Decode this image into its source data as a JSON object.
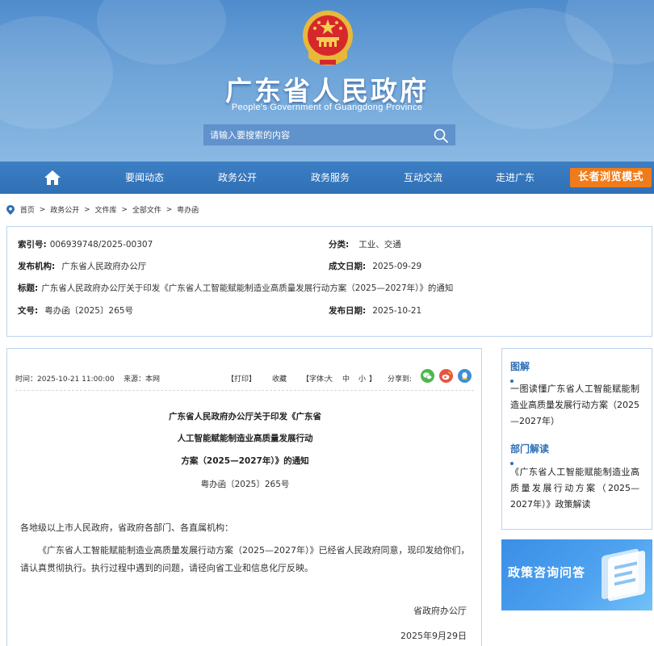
{
  "header": {
    "title": "广东省人民政府",
    "subtitle": "People's Government of Guangdong Province",
    "search_placeholder": "请输入要搜索的内容",
    "icons": {
      "emblem": "national-emblem",
      "search": "search-icon"
    }
  },
  "nav": {
    "home_icon": "home-icon",
    "items": [
      "要闻动态",
      "政务公开",
      "政务服务",
      "互动交流",
      "走进广东"
    ],
    "elder_mode": "长者浏览模式",
    "accent": "#f07b1a"
  },
  "breadcrumb": [
    "首页",
    "政务公开",
    "文件库",
    "全部文件",
    "粤办函"
  ],
  "meta": {
    "index_no_label": "索引号:",
    "index_no": "006939748/2025-00307",
    "category_label": "分类:",
    "category": "工业、交通",
    "publisher_label": "发布机构:",
    "publisher": "广东省人民政府办公厅",
    "written_date_label": "成文日期:",
    "written_date": "2025-09-29",
    "title_label": "标题:",
    "title": "广东省人民政府办公厅关于印发《广东省人工智能赋能制造业高质量发展行动方案（2025—2027年）》的通知",
    "doc_no_label": "文号:",
    "doc_no": "粤办函〔2025〕265号",
    "publish_date_label": "发布日期:",
    "publish_date": "2025-10-21"
  },
  "article": {
    "time": "时间：2025-10-21 11:00:00",
    "source": "来源：本网",
    "print": "【打印】",
    "favorite": "收藏",
    "font_label": "【字体:",
    "font_large": "大",
    "font_medium": "中",
    "font_small": "小",
    "font_close": "】",
    "share_label": "分享到:",
    "share_icons": [
      "wechat-icon",
      "weibo-icon",
      "qq-icon"
    ],
    "title_lines": [
      "广东省人民政府办公厅关于印发《广东省",
      "人工智能赋能制造业高质量发展行动",
      "方案（2025—2027年）》的通知"
    ],
    "doc_no": "粤办函〔2025〕265号",
    "salutation": "各地级以上市人民政府，省政府各部门、各直属机构：",
    "body": "《广东省人工智能赋能制造业高质量发展行动方案（2025—2027年）》已经省人民政府同意，现印发给你们，请认真贯彻执行。执行过程中遇到的问题，请径向省工业和信息化厅反映。",
    "signer": "省政府办公厅",
    "sign_date": "2025年9月29日"
  },
  "sidebar": {
    "graphic_head": "图解",
    "graphic_link": "一图读懂广东省人工智能赋能制造业高质量发展行动方案（2025—2027年）",
    "dept_head": "部门解读",
    "dept_link": "《广东省人工智能赋能制造业高质量发展行动方案（2025—2027年）》政策解读",
    "consult": "政策咨询问答"
  }
}
